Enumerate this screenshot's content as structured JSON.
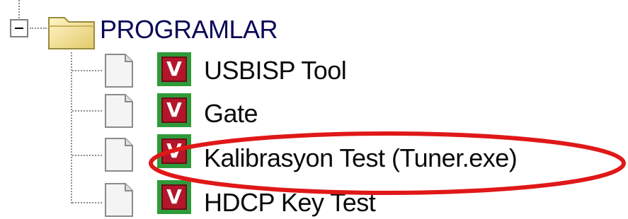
{
  "tree": {
    "root": {
      "label": "PROGRAMLAR",
      "expanded": true,
      "folder_icon": "folder-icon"
    },
    "items": [
      {
        "label": "USBISP Tool",
        "icon": "app-v-icon",
        "glyph": "V"
      },
      {
        "label": "Gate",
        "icon": "app-v-icon",
        "glyph": "V"
      },
      {
        "label": "Kalibrasyon Test (Tuner.exe)",
        "icon": "app-v-icon",
        "glyph": "V",
        "highlighted": true
      },
      {
        "label": "HDCP Key Test",
        "icon": "app-v-icon",
        "glyph": "V"
      }
    ]
  },
  "colors": {
    "app_icon_border": "#2e9b3a",
    "app_icon_fill": "#b3162a",
    "highlight_ellipse": "#e01818",
    "folder_fill": "#f3e6a0",
    "tree_line": "#8c8c8c"
  }
}
